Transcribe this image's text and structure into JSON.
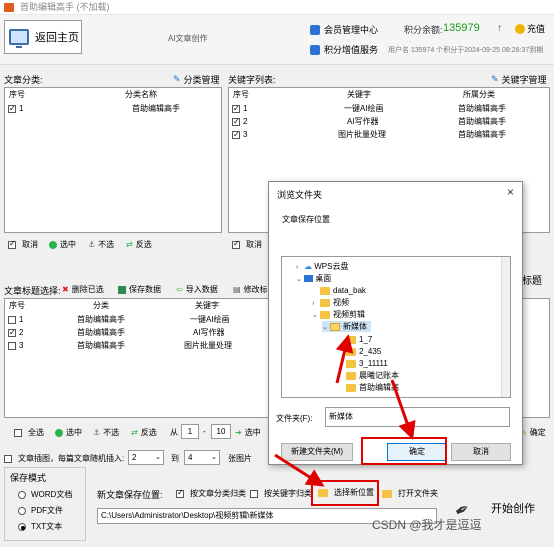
{
  "window": {
    "title": "首助编辑高手 (不加载)"
  },
  "header": {
    "home_label": "返回主页",
    "app_name": "AI文章创作",
    "member_label": "会员管理中心",
    "points_label": "积分余额:",
    "points_value": "135979",
    "arrow_up": "↑",
    "recharge_label": "充值",
    "vip_label": "积分增值服务",
    "expire_text": "用户名 135974 个积分于2024-09-25 08:26:37到期"
  },
  "article_category": {
    "label": "文章分类:",
    "manage_label": "分类管理",
    "columns": [
      "序号",
      "分类名称"
    ],
    "rows": [
      {
        "checked": true,
        "index": "1",
        "name": "首助编辑高手"
      }
    ],
    "toolbar": {
      "cancel": "取消",
      "select": "选中",
      "unselect": "不选",
      "invert": "反选"
    }
  },
  "keyword_list": {
    "label": "关键字列表:",
    "manage_label": "关键字管理",
    "columns": [
      "序号",
      "关键字",
      "所属分类"
    ],
    "rows": [
      {
        "checked": true,
        "index": "1",
        "keyword": "一键AI绘画",
        "category": "首助编辑高手"
      },
      {
        "checked": true,
        "index": "2",
        "keyword": "AI写作器",
        "category": "首助编辑高手"
      },
      {
        "checked": true,
        "index": "3",
        "keyword": "图片批量处理",
        "category": "首助编辑高手"
      }
    ],
    "toolbar": {
      "cancel": "取消"
    }
  },
  "title_select": {
    "label": "文章标题选择:",
    "delete_label": "删除已选",
    "save_label": "保存数据",
    "import_label": "导入数据",
    "modify_label": "修改标",
    "right_label": "标题",
    "columns": [
      "序号",
      "分类",
      "关键字"
    ],
    "rows": [
      {
        "checked": false,
        "index": "1",
        "category": "首助编辑高手",
        "keyword": "一键AI绘画"
      },
      {
        "checked": true,
        "index": "2",
        "category": "首助编辑高手",
        "keyword": "AI写作器"
      },
      {
        "checked": false,
        "index": "3",
        "category": "首助编辑高手",
        "keyword": "图片批量处理"
      }
    ],
    "toolbar": {
      "select_all": "全选",
      "select": "选中",
      "unselect": "不选",
      "invert": "反选",
      "from": "从",
      "from_value": "1",
      "dash": "-",
      "to_value": "10",
      "select_tail": "选中",
      "confirm": "确定"
    }
  },
  "insert_image": {
    "label": "文章插图，每篇文章随机插入:",
    "min": "2",
    "to": "到",
    "max": "4",
    "unit": "张图片"
  },
  "save_mode": {
    "label": "保存模式",
    "options": [
      {
        "label": "WORD文档",
        "selected": false
      },
      {
        "label": "PDF文件",
        "selected": false
      },
      {
        "label": "TXT文本",
        "selected": true
      }
    ]
  },
  "save_location": {
    "label": "新文章保存位置:",
    "by_category": "按文章分类归类",
    "by_keyword": "按关键字归类",
    "choose_label": "选择新位置",
    "open_label": "打开文件夹",
    "path": "C:\\Users\\Administrator\\Desktop\\视频剪辑\\新媒体",
    "start_label": "开始创作"
  },
  "dialog": {
    "title": "浏览文件夹",
    "close": "×",
    "prompt": "文章保存位置",
    "tree": [
      {
        "label": "WPS云盘",
        "chev": "›",
        "icon": "cloud"
      },
      {
        "label": "桌面",
        "chev": "⌄",
        "icon": "desktop"
      },
      {
        "label": "data_bak",
        "chev": "",
        "icon": "folder"
      },
      {
        "label": "视频",
        "chev": "›",
        "icon": "folder"
      },
      {
        "label": "视频剪辑",
        "chev": "⌄",
        "icon": "folder"
      },
      {
        "label": "新媒体",
        "chev": "⌄",
        "icon": "folder-open",
        "selected": true
      },
      {
        "label": "1_7",
        "chev": "",
        "icon": "folder"
      },
      {
        "label": "2_435",
        "chev": "",
        "icon": "folder"
      },
      {
        "label": "3_11111",
        "chev": "",
        "icon": "folder"
      },
      {
        "label": "晨曦记账本",
        "chev": "",
        "icon": "folder"
      },
      {
        "label": "首助编辑高",
        "chev": "",
        "icon": "folder"
      }
    ],
    "folder_label": "文件夹(F):",
    "folder_value": "新媒体",
    "new_folder": "新建文件夹(M)",
    "ok": "确定",
    "cancel": "取消"
  },
  "watermark": "CSDN @我才是逗逗"
}
